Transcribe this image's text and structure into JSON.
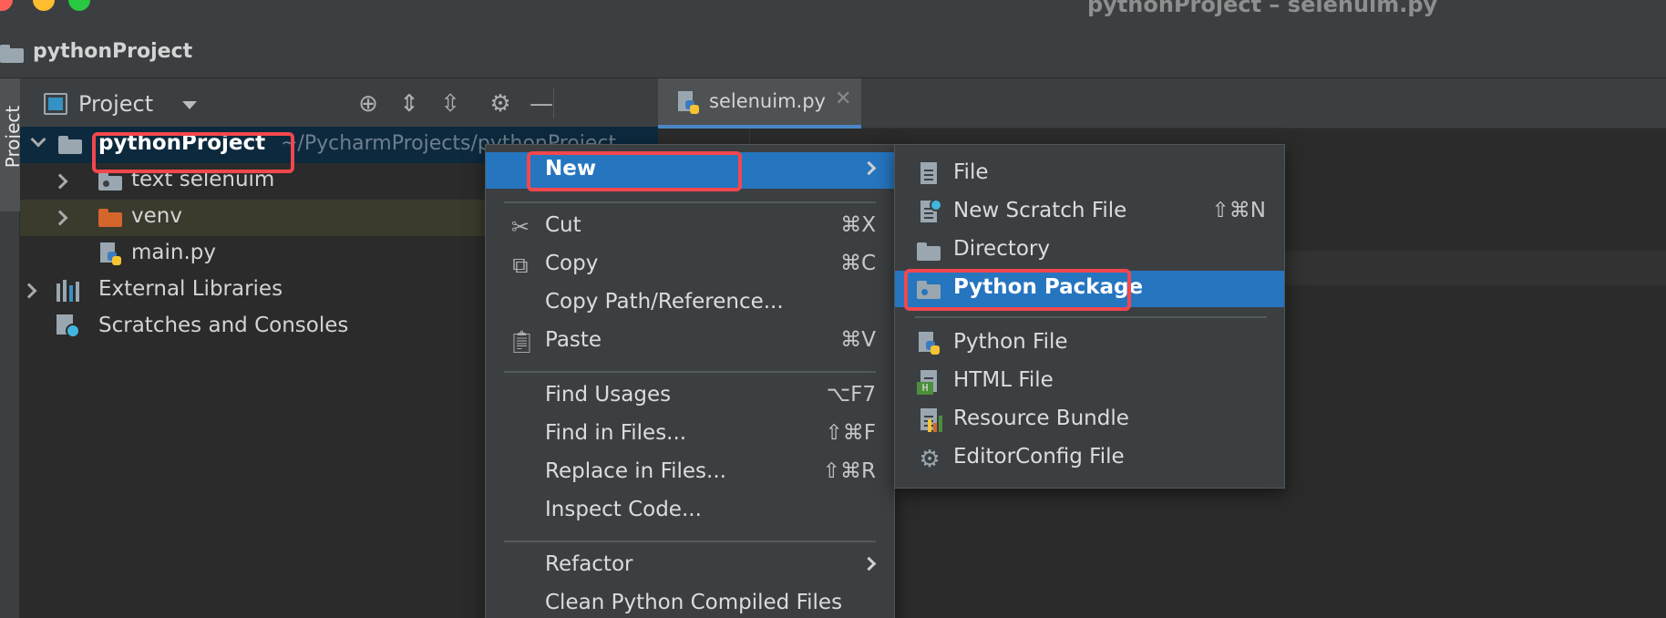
{
  "window": {
    "title": "pythonProject – selenuim.py"
  },
  "navbar": {
    "project": "pythonProject"
  },
  "side_strip": {
    "label": "Project"
  },
  "project_panel": {
    "title": "Project",
    "tree": {
      "root": {
        "name": "pythonProject",
        "path": "~/PycharmProjects/pythonProject"
      },
      "children": [
        {
          "name": "text selenuim"
        },
        {
          "name": "venv"
        },
        {
          "name": "main.py"
        }
      ],
      "external_libraries": "External Libraries",
      "scratches": "Scratches and Consoles"
    }
  },
  "editor": {
    "tab_label": "selenuim.py"
  },
  "context_menu": {
    "new": "New",
    "cut": {
      "label": "Cut",
      "shortcut": "⌘X"
    },
    "copy": {
      "label": "Copy",
      "shortcut": "⌘C"
    },
    "copy_path": {
      "label": "Copy Path/Reference..."
    },
    "paste": {
      "label": "Paste",
      "shortcut": "⌘V"
    },
    "find_usages": {
      "label": "Find Usages",
      "shortcut": "⌥F7"
    },
    "find_in_files": {
      "label": "Find in Files...",
      "shortcut": "⇧⌘F"
    },
    "replace_in_files": {
      "label": "Replace in Files...",
      "shortcut": "⇧⌘R"
    },
    "inspect_code": {
      "label": "Inspect Code..."
    },
    "refactor": {
      "label": "Refactor"
    },
    "clean_compiled": {
      "label": "Clean Python Compiled Files"
    }
  },
  "new_submenu": {
    "file": "File",
    "new_scratch_file": {
      "label": "New Scratch File",
      "shortcut": "⇧⌘N"
    },
    "directory": "Directory",
    "python_package": "Python Package",
    "python_file": "Python File",
    "html_file": "HTML File",
    "resource_bundle": "Resource Bundle",
    "editorconfig_file": "EditorConfig File"
  },
  "colors": {
    "highlight": "#2675bf",
    "annotation_box": "#f2474d",
    "tree_selection": "#0d293e",
    "venv_folder": "#d4662b"
  }
}
